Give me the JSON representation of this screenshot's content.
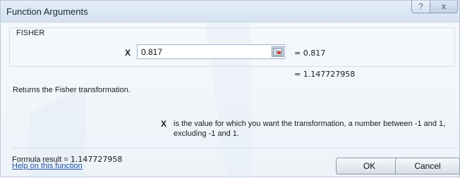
{
  "window": {
    "title": "Function Arguments",
    "help_button": "?",
    "close_button": "x"
  },
  "function": {
    "name": "FISHER",
    "argument_label": "X",
    "argument_value": "0.817",
    "argument_result": "= 0.817",
    "function_result": "= 1.147727958"
  },
  "description": "Returns the Fisher transformation.",
  "argument_help": {
    "label": "X",
    "text": "is the value for which you want the transformation, a number between -1 and 1, excluding -1 and 1."
  },
  "formula_result": {
    "label": "Formula result =",
    "value": "1.147727958"
  },
  "help_link": "Help on this function",
  "buttons": {
    "ok": "OK",
    "cancel": "Cancel"
  }
}
